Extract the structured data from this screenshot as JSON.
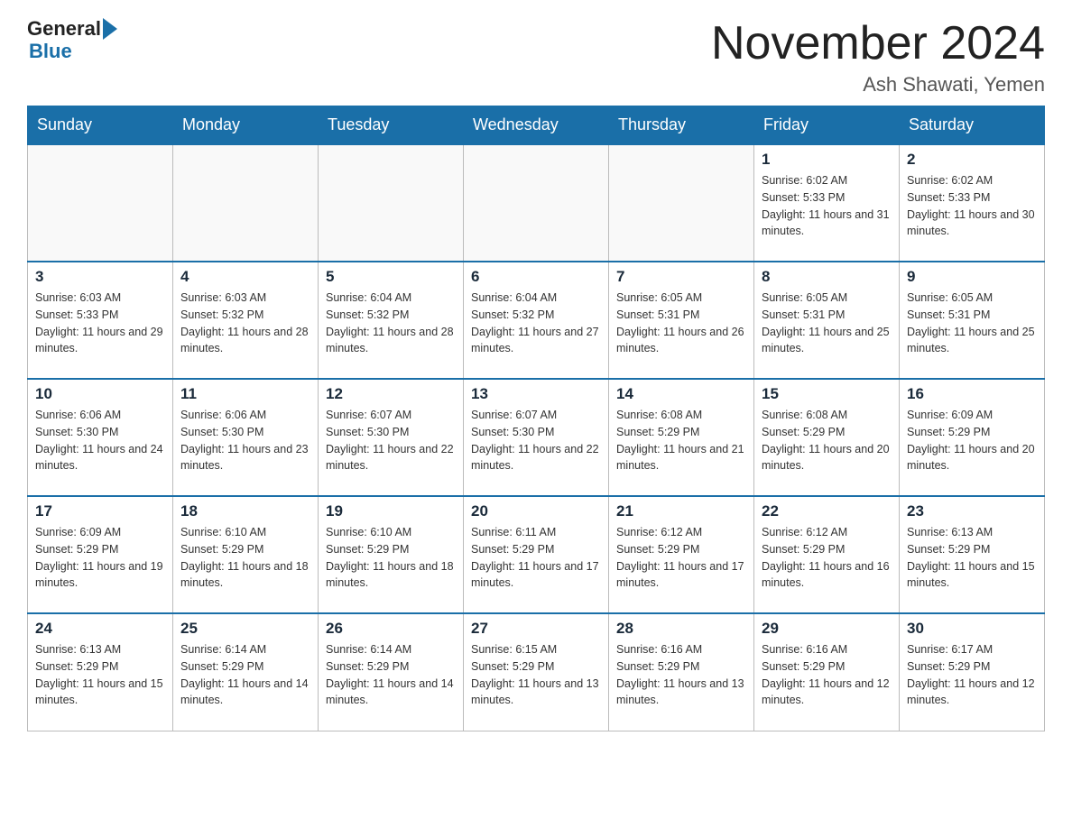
{
  "logo": {
    "text_general": "General",
    "text_blue": "Blue"
  },
  "header": {
    "month_title": "November 2024",
    "location": "Ash Shawati, Yemen"
  },
  "weekdays": [
    "Sunday",
    "Monday",
    "Tuesday",
    "Wednesday",
    "Thursday",
    "Friday",
    "Saturday"
  ],
  "weeks": [
    [
      {
        "day": "",
        "sunrise": "",
        "sunset": "",
        "daylight": ""
      },
      {
        "day": "",
        "sunrise": "",
        "sunset": "",
        "daylight": ""
      },
      {
        "day": "",
        "sunrise": "",
        "sunset": "",
        "daylight": ""
      },
      {
        "day": "",
        "sunrise": "",
        "sunset": "",
        "daylight": ""
      },
      {
        "day": "",
        "sunrise": "",
        "sunset": "",
        "daylight": ""
      },
      {
        "day": "1",
        "sunrise": "Sunrise: 6:02 AM",
        "sunset": "Sunset: 5:33 PM",
        "daylight": "Daylight: 11 hours and 31 minutes."
      },
      {
        "day": "2",
        "sunrise": "Sunrise: 6:02 AM",
        "sunset": "Sunset: 5:33 PM",
        "daylight": "Daylight: 11 hours and 30 minutes."
      }
    ],
    [
      {
        "day": "3",
        "sunrise": "Sunrise: 6:03 AM",
        "sunset": "Sunset: 5:33 PM",
        "daylight": "Daylight: 11 hours and 29 minutes."
      },
      {
        "day": "4",
        "sunrise": "Sunrise: 6:03 AM",
        "sunset": "Sunset: 5:32 PM",
        "daylight": "Daylight: 11 hours and 28 minutes."
      },
      {
        "day": "5",
        "sunrise": "Sunrise: 6:04 AM",
        "sunset": "Sunset: 5:32 PM",
        "daylight": "Daylight: 11 hours and 28 minutes."
      },
      {
        "day": "6",
        "sunrise": "Sunrise: 6:04 AM",
        "sunset": "Sunset: 5:32 PM",
        "daylight": "Daylight: 11 hours and 27 minutes."
      },
      {
        "day": "7",
        "sunrise": "Sunrise: 6:05 AM",
        "sunset": "Sunset: 5:31 PM",
        "daylight": "Daylight: 11 hours and 26 minutes."
      },
      {
        "day": "8",
        "sunrise": "Sunrise: 6:05 AM",
        "sunset": "Sunset: 5:31 PM",
        "daylight": "Daylight: 11 hours and 25 minutes."
      },
      {
        "day": "9",
        "sunrise": "Sunrise: 6:05 AM",
        "sunset": "Sunset: 5:31 PM",
        "daylight": "Daylight: 11 hours and 25 minutes."
      }
    ],
    [
      {
        "day": "10",
        "sunrise": "Sunrise: 6:06 AM",
        "sunset": "Sunset: 5:30 PM",
        "daylight": "Daylight: 11 hours and 24 minutes."
      },
      {
        "day": "11",
        "sunrise": "Sunrise: 6:06 AM",
        "sunset": "Sunset: 5:30 PM",
        "daylight": "Daylight: 11 hours and 23 minutes."
      },
      {
        "day": "12",
        "sunrise": "Sunrise: 6:07 AM",
        "sunset": "Sunset: 5:30 PM",
        "daylight": "Daylight: 11 hours and 22 minutes."
      },
      {
        "day": "13",
        "sunrise": "Sunrise: 6:07 AM",
        "sunset": "Sunset: 5:30 PM",
        "daylight": "Daylight: 11 hours and 22 minutes."
      },
      {
        "day": "14",
        "sunrise": "Sunrise: 6:08 AM",
        "sunset": "Sunset: 5:29 PM",
        "daylight": "Daylight: 11 hours and 21 minutes."
      },
      {
        "day": "15",
        "sunrise": "Sunrise: 6:08 AM",
        "sunset": "Sunset: 5:29 PM",
        "daylight": "Daylight: 11 hours and 20 minutes."
      },
      {
        "day": "16",
        "sunrise": "Sunrise: 6:09 AM",
        "sunset": "Sunset: 5:29 PM",
        "daylight": "Daylight: 11 hours and 20 minutes."
      }
    ],
    [
      {
        "day": "17",
        "sunrise": "Sunrise: 6:09 AM",
        "sunset": "Sunset: 5:29 PM",
        "daylight": "Daylight: 11 hours and 19 minutes."
      },
      {
        "day": "18",
        "sunrise": "Sunrise: 6:10 AM",
        "sunset": "Sunset: 5:29 PM",
        "daylight": "Daylight: 11 hours and 18 minutes."
      },
      {
        "day": "19",
        "sunrise": "Sunrise: 6:10 AM",
        "sunset": "Sunset: 5:29 PM",
        "daylight": "Daylight: 11 hours and 18 minutes."
      },
      {
        "day": "20",
        "sunrise": "Sunrise: 6:11 AM",
        "sunset": "Sunset: 5:29 PM",
        "daylight": "Daylight: 11 hours and 17 minutes."
      },
      {
        "day": "21",
        "sunrise": "Sunrise: 6:12 AM",
        "sunset": "Sunset: 5:29 PM",
        "daylight": "Daylight: 11 hours and 17 minutes."
      },
      {
        "day": "22",
        "sunrise": "Sunrise: 6:12 AM",
        "sunset": "Sunset: 5:29 PM",
        "daylight": "Daylight: 11 hours and 16 minutes."
      },
      {
        "day": "23",
        "sunrise": "Sunrise: 6:13 AM",
        "sunset": "Sunset: 5:29 PM",
        "daylight": "Daylight: 11 hours and 15 minutes."
      }
    ],
    [
      {
        "day": "24",
        "sunrise": "Sunrise: 6:13 AM",
        "sunset": "Sunset: 5:29 PM",
        "daylight": "Daylight: 11 hours and 15 minutes."
      },
      {
        "day": "25",
        "sunrise": "Sunrise: 6:14 AM",
        "sunset": "Sunset: 5:29 PM",
        "daylight": "Daylight: 11 hours and 14 minutes."
      },
      {
        "day": "26",
        "sunrise": "Sunrise: 6:14 AM",
        "sunset": "Sunset: 5:29 PM",
        "daylight": "Daylight: 11 hours and 14 minutes."
      },
      {
        "day": "27",
        "sunrise": "Sunrise: 6:15 AM",
        "sunset": "Sunset: 5:29 PM",
        "daylight": "Daylight: 11 hours and 13 minutes."
      },
      {
        "day": "28",
        "sunrise": "Sunrise: 6:16 AM",
        "sunset": "Sunset: 5:29 PM",
        "daylight": "Daylight: 11 hours and 13 minutes."
      },
      {
        "day": "29",
        "sunrise": "Sunrise: 6:16 AM",
        "sunset": "Sunset: 5:29 PM",
        "daylight": "Daylight: 11 hours and 12 minutes."
      },
      {
        "day": "30",
        "sunrise": "Sunrise: 6:17 AM",
        "sunset": "Sunset: 5:29 PM",
        "daylight": "Daylight: 11 hours and 12 minutes."
      }
    ]
  ]
}
